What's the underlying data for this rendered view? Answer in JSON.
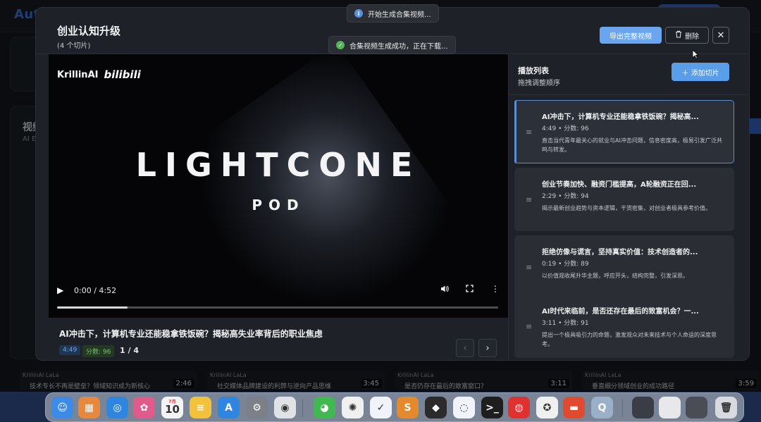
{
  "bg": {
    "app_logo": "Auto",
    "section_title": "视频",
    "section_sub": "AI E",
    "thumbs": [
      {
        "logo": "KrillinAI LaLa",
        "text": "技术专长不再是壁垒？领域知识成为新核心",
        "time": "2:46"
      },
      {
        "logo": "KrillinAI LaLa",
        "text": "社交媒体品牌建设的利弊与逆向产品思维",
        "time": "3:45"
      },
      {
        "logo": "KrillinAI LaLa",
        "text": "是否仍存在最后的致富窗口？",
        "time": "3:11"
      },
      {
        "logo": "KrillinAI LaLa",
        "text": "垂直细分领域创业的成功路径",
        "time": "3:59"
      }
    ]
  },
  "toasts": {
    "info_text": "开始生成合集视频...",
    "success_text": "合集视频生成成功，正在下载..."
  },
  "modal": {
    "title": "创业认知升级",
    "subtitle": "(4 个切片)",
    "export_label": "导出完整视频",
    "delete_label": "删除",
    "close_glyph": "✕"
  },
  "video": {
    "brand_left": "KrillinAI",
    "brand_right": "bilibili",
    "title": "LIGHTCONE",
    "subtitle": "POD",
    "time_text": "0:00 / 4:52",
    "progress": 0.16
  },
  "current_clip": {
    "title": "AI冲击下，计算机专业还能稳拿铁饭碗？揭秘高失业率背后的职业焦虑",
    "duration": "4:49",
    "score": "分数: 96",
    "index": "1 / 4"
  },
  "playlist": {
    "title": "播放列表",
    "subtitle": "拖拽调整顺序",
    "add_label": "添加切片",
    "items": [
      {
        "title": "AI冲击下，计算机专业还能稳拿铁饭碗？揭秘高...",
        "meta": "4:49 • 分数: 96",
        "desc": "直击当代青年最关心的就业与AI冲击问题，信息密度高，极易引发广泛共鸣与转发。"
      },
      {
        "title": "创业节奏加快、融资门槛提高，A轮融资正在回...",
        "meta": "2:29 • 分数: 94",
        "desc": "揭示最新创业趋势与资本逻辑，干货密集，对创业者极具参考价值。"
      },
      {
        "title": "拒绝仿像与谎言，坚持真实价值：技术创造者的...",
        "meta": "0:19 • 分数: 89",
        "desc": "以价值观收尾升华主题，呼应开头，结构完整，引发深思。"
      },
      {
        "title": "AI时代来临前，是否还存在最后的致富机会？一...",
        "meta": "3:11 • 分数: 91",
        "desc": "提出一个极具吸引力的命题，激发观众对未来技术与个人命运的深度思考。"
      }
    ]
  },
  "dock": {
    "date_month": "7月",
    "date_day": "10",
    "icons": [
      {
        "name": "finder-icon",
        "color": "#3d8be8",
        "glyph": "☺"
      },
      {
        "name": "launchpad-icon",
        "color": "#e8883d",
        "glyph": "▦"
      },
      {
        "name": "safari-icon",
        "color": "#2f86e0",
        "glyph": "◎"
      },
      {
        "name": "photos-icon",
        "color": "#e05a8a",
        "glyph": "✿"
      },
      {
        "name": "calendar-icon",
        "color": "#f4f4f4",
        "glyph": ""
      },
      {
        "name": "notes-icon",
        "color": "#f2c23a",
        "glyph": "≡"
      },
      {
        "name": "app-store-icon",
        "color": "#2f86e0",
        "glyph": "A"
      },
      {
        "name": "settings-icon",
        "color": "#7c8089",
        "glyph": "⚙"
      },
      {
        "name": "chrome-icon",
        "color": "#e0e3e6",
        "glyph": "◉"
      },
      {
        "name": "wechat-icon",
        "color": "#3fb950",
        "glyph": "◕"
      },
      {
        "name": "chatgpt-icon",
        "color": "#f0f0f0",
        "glyph": "✺"
      },
      {
        "name": "lark-icon",
        "color": "#f0f4fa",
        "glyph": "✓"
      },
      {
        "name": "sublime-icon",
        "color": "#e58a2c",
        "glyph": "S"
      },
      {
        "name": "package-icon",
        "color": "#2b2b2b",
        "glyph": "◆"
      },
      {
        "name": "chat-bubble-icon",
        "color": "#f0f4fa",
        "glyph": "◌"
      },
      {
        "name": "terminal-icon",
        "color": "#1e1e1e",
        "glyph": ">_"
      },
      {
        "name": "netease-music-icon",
        "color": "#e0302f",
        "glyph": "◍"
      },
      {
        "name": "qq-icon",
        "color": "#f0f0f0",
        "glyph": "✪"
      },
      {
        "name": "slides-icon",
        "color": "#e04a2f",
        "glyph": "▬"
      },
      {
        "name": "quicktime-icon",
        "color": "#9ab0c8",
        "glyph": "Q"
      },
      {
        "name": "window-thumb-icon",
        "color": "#3a3d45",
        "glyph": ""
      },
      {
        "name": "window-thumb-icon-2",
        "color": "#e8e8ea",
        "glyph": ""
      },
      {
        "name": "window-thumb-icon-3",
        "color": "#4a4d55",
        "glyph": ""
      },
      {
        "name": "trash-icon",
        "color": "#d8dadf",
        "glyph": "🗑"
      }
    ]
  }
}
